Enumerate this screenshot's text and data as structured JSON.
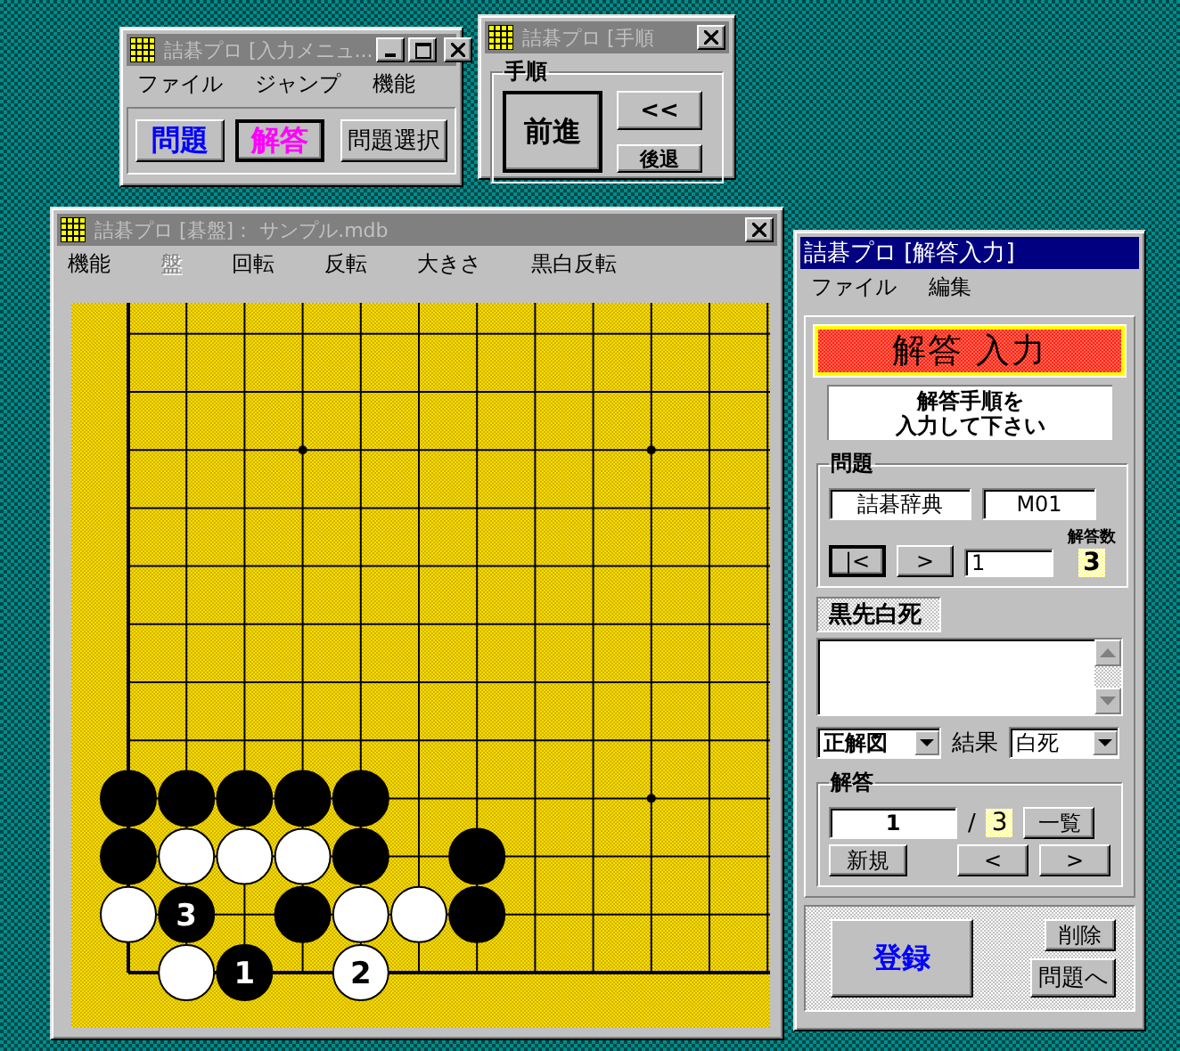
{
  "input_menu_window": {
    "title": "詰碁プロ [入力メニュ...",
    "active": false,
    "menu": [
      "ファイル",
      "ジャンプ",
      "機能"
    ],
    "buttons": [
      {
        "label": "問題",
        "color": "#0000ff",
        "selected": false
      },
      {
        "label": "解答",
        "color": "#ff00ff",
        "selected": true
      },
      {
        "label": "問題選択",
        "color": "#000000",
        "selected": false
      }
    ]
  },
  "sequence_window": {
    "title": "詰碁プロ [手順",
    "active": false,
    "group_label": "手順",
    "buttons": [
      {
        "label": "前進",
        "kind": "large"
      },
      {
        "label": "<<",
        "kind": "small"
      },
      {
        "label": "後退",
        "kind": "small"
      }
    ]
  },
  "board_window": {
    "title": "詰碁プロ [碁盤]： サンプル.mdb",
    "active": false,
    "menu": [
      {
        "label": "機能",
        "disabled": false
      },
      {
        "label": "盤",
        "disabled": true
      },
      {
        "label": "回転",
        "disabled": false
      },
      {
        "label": "反転",
        "disabled": false
      },
      {
        "label": "大きさ",
        "disabled": false
      },
      {
        "label": "黒白反転",
        "disabled": false
      }
    ],
    "board": {
      "grid": [
        [
          {
            "kind": "empty"
          },
          {
            "kind": "empty"
          },
          {
            "kind": "empty"
          },
          {
            "kind": "empty"
          },
          {
            "kind": "empty"
          },
          {
            "kind": "empty"
          },
          {
            "kind": "empty"
          },
          {
            "kind": "empty"
          },
          {
            "kind": "empty"
          },
          {
            "kind": "empty"
          },
          {
            "kind": "empty"
          },
          {
            "kind": "empty"
          }
        ],
        [
          {
            "kind": "empty"
          },
          {
            "kind": "empty"
          },
          {
            "kind": "empty"
          },
          {
            "kind": "empty"
          },
          {
            "kind": "empty"
          },
          {
            "kind": "empty"
          },
          {
            "kind": "empty"
          },
          {
            "kind": "empty"
          },
          {
            "kind": "empty"
          },
          {
            "kind": "empty"
          },
          {
            "kind": "empty"
          },
          {
            "kind": "empty"
          }
        ],
        [
          {
            "kind": "empty"
          },
          {
            "kind": "empty"
          },
          {
            "kind": "empty"
          },
          {
            "kind": "star"
          },
          {
            "kind": "empty"
          },
          {
            "kind": "empty"
          },
          {
            "kind": "empty"
          },
          {
            "kind": "empty"
          },
          {
            "kind": "empty"
          },
          {
            "kind": "star"
          },
          {
            "kind": "empty"
          },
          {
            "kind": "empty"
          }
        ],
        [
          {
            "kind": "empty"
          },
          {
            "kind": "empty"
          },
          {
            "kind": "empty"
          },
          {
            "kind": "empty"
          },
          {
            "kind": "empty"
          },
          {
            "kind": "empty"
          },
          {
            "kind": "empty"
          },
          {
            "kind": "empty"
          },
          {
            "kind": "empty"
          },
          {
            "kind": "empty"
          },
          {
            "kind": "empty"
          },
          {
            "kind": "empty"
          }
        ],
        [
          {
            "kind": "empty"
          },
          {
            "kind": "empty"
          },
          {
            "kind": "empty"
          },
          {
            "kind": "empty"
          },
          {
            "kind": "empty"
          },
          {
            "kind": "empty"
          },
          {
            "kind": "empty"
          },
          {
            "kind": "empty"
          },
          {
            "kind": "empty"
          },
          {
            "kind": "empty"
          },
          {
            "kind": "empty"
          },
          {
            "kind": "empty"
          }
        ],
        [
          {
            "kind": "empty"
          },
          {
            "kind": "empty"
          },
          {
            "kind": "empty"
          },
          {
            "kind": "empty"
          },
          {
            "kind": "empty"
          },
          {
            "kind": "empty"
          },
          {
            "kind": "empty"
          },
          {
            "kind": "empty"
          },
          {
            "kind": "empty"
          },
          {
            "kind": "empty"
          },
          {
            "kind": "empty"
          },
          {
            "kind": "empty"
          }
        ],
        [
          {
            "kind": "empty"
          },
          {
            "kind": "empty"
          },
          {
            "kind": "empty"
          },
          {
            "kind": "empty"
          },
          {
            "kind": "empty"
          },
          {
            "kind": "empty"
          },
          {
            "kind": "empty"
          },
          {
            "kind": "empty"
          },
          {
            "kind": "empty"
          },
          {
            "kind": "empty"
          },
          {
            "kind": "empty"
          },
          {
            "kind": "empty"
          }
        ],
        [
          {
            "kind": "empty"
          },
          {
            "kind": "empty"
          },
          {
            "kind": "empty"
          },
          {
            "kind": "empty"
          },
          {
            "kind": "empty"
          },
          {
            "kind": "empty"
          },
          {
            "kind": "empty"
          },
          {
            "kind": "empty"
          },
          {
            "kind": "empty"
          },
          {
            "kind": "empty"
          },
          {
            "kind": "empty"
          },
          {
            "kind": "empty"
          }
        ],
        [
          {
            "kind": "black"
          },
          {
            "kind": "black"
          },
          {
            "kind": "black"
          },
          {
            "kind": "black"
          },
          {
            "kind": "black"
          },
          {
            "kind": "empty"
          },
          {
            "kind": "empty"
          },
          {
            "kind": "empty"
          },
          {
            "kind": "empty"
          },
          {
            "kind": "star"
          },
          {
            "kind": "empty"
          },
          {
            "kind": "empty"
          }
        ],
        [
          {
            "kind": "black"
          },
          {
            "kind": "white"
          },
          {
            "kind": "white"
          },
          {
            "kind": "white"
          },
          {
            "kind": "black"
          },
          {
            "kind": "empty"
          },
          {
            "kind": "black"
          },
          {
            "kind": "empty"
          },
          {
            "kind": "empty"
          },
          {
            "kind": "empty"
          },
          {
            "kind": "empty"
          },
          {
            "kind": "empty"
          }
        ],
        [
          {
            "kind": "white"
          },
          {
            "kind": "black",
            "label": "3"
          },
          {
            "kind": "empty"
          },
          {
            "kind": "black"
          },
          {
            "kind": "white"
          },
          {
            "kind": "white"
          },
          {
            "kind": "black"
          },
          {
            "kind": "empty"
          },
          {
            "kind": "empty"
          },
          {
            "kind": "empty"
          },
          {
            "kind": "empty"
          },
          {
            "kind": "empty"
          }
        ],
        [
          {
            "kind": "empty"
          },
          {
            "kind": "white"
          },
          {
            "kind": "black",
            "label": "1"
          },
          {
            "kind": "empty"
          },
          {
            "kind": "white",
            "label": "2"
          },
          {
            "kind": "empty"
          },
          {
            "kind": "empty"
          },
          {
            "kind": "empty"
          },
          {
            "kind": "empty"
          },
          {
            "kind": "empty"
          },
          {
            "kind": "empty"
          },
          {
            "kind": "empty"
          }
        ]
      ]
    }
  },
  "answer_window": {
    "title": "詰碁プロ [解答入力]",
    "active": true,
    "menu": [
      "ファイル",
      "編集"
    ],
    "banner": "解答 入力",
    "instruction_lines": [
      "解答手順を",
      "入力して下さい"
    ],
    "problem": {
      "label": "問題",
      "collection": "詰碁辞典",
      "problem_id": "M01",
      "first_button": "|<",
      "next_button": ">",
      "number": "1",
      "answer_count_label": "解答数",
      "answer_count": "3"
    },
    "problem_title": "黒先白死",
    "diagram_type": "正解図",
    "result_label": "結果",
    "result": "白死",
    "answer": {
      "label": "解答",
      "number": "1",
      "separator": "/",
      "total": "3",
      "list_button": "一覧",
      "new_button": "新規",
      "prev_button": "<",
      "next_button": ">"
    },
    "register_button": "登録",
    "delete_button": "削除",
    "to_problem_button": "問題へ"
  }
}
